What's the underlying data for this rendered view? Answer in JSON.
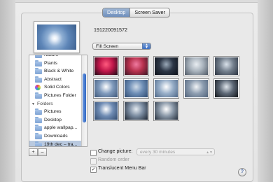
{
  "tabs": [
    {
      "label": "Desktop",
      "active": true
    },
    {
      "label": "Screen Saver",
      "active": false
    }
  ],
  "preview": {
    "image_name": "191220091572"
  },
  "fit_popup": {
    "selected": "Fill Screen"
  },
  "source_list": {
    "items": [
      {
        "label": "Nature",
        "icon": "folder-icon"
      },
      {
        "label": "Plants",
        "icon": "folder-icon"
      },
      {
        "label": "Black & White",
        "icon": "folder-icon"
      },
      {
        "label": "Abstract",
        "icon": "folder-icon"
      },
      {
        "label": "Solid Colors",
        "icon": "color-wheel-icon"
      },
      {
        "label": "Pictures Folder",
        "icon": "folder-icon"
      }
    ],
    "folders_header": "Folders",
    "folders": [
      {
        "label": "Pictures",
        "icon": "folder-icon"
      },
      {
        "label": "Desktop",
        "icon": "folder-icon"
      },
      {
        "label": "apple wallpap...",
        "icon": "folder-icon"
      },
      {
        "label": "Downloads",
        "icon": "folder-icon"
      },
      {
        "label": "19th dec – tra...",
        "icon": "folder-icon",
        "selected": true
      }
    ],
    "add_label": "+",
    "remove_label": "–"
  },
  "thumbnails": [
    {
      "name": "flowers-red",
      "colors": [
        "#1b0a14",
        "#c0164a",
        "#ff5a7e"
      ]
    },
    {
      "name": "flowers-pink",
      "colors": [
        "#3a1624",
        "#b8314e",
        "#f07aa0"
      ]
    },
    {
      "name": "dark-tree-sky",
      "colors": [
        "#0c1018",
        "#2c3646",
        "#9aa9b8"
      ]
    },
    {
      "name": "cloudy-sky-1",
      "colors": [
        "#4f5965",
        "#a9b3bd",
        "#e8edf1"
      ]
    },
    {
      "name": "cloudy-sky-2",
      "colors": [
        "#2b3340",
        "#74808e",
        "#d9e1ea"
      ]
    },
    {
      "name": "sun-sky-1",
      "colors": [
        "#3d5678",
        "#7f9abc",
        "#ffffff"
      ]
    },
    {
      "name": "blue-sky-1",
      "colors": [
        "#2e4a70",
        "#6d8db5",
        "#cfdbe8"
      ]
    },
    {
      "name": "bright-clouds",
      "colors": [
        "#4d6686",
        "#97aec8",
        "#ffffff"
      ]
    },
    {
      "name": "clouds-gray",
      "colors": [
        "#50627a",
        "#8d9db0",
        "#f2f4f6"
      ]
    },
    {
      "name": "tree-silhouette",
      "colors": [
        "#111418",
        "#5d6876",
        "#dfe5eb"
      ]
    },
    {
      "name": "sun-sky-2",
      "colors": [
        "#30496c",
        "#6f8cb4",
        "#ffffff"
      ]
    },
    {
      "name": "sky-horizon",
      "colors": [
        "#1c2430",
        "#7a8ba0",
        "#e5ebf1"
      ]
    },
    {
      "name": "sun-ground",
      "colors": [
        "#26303d",
        "#8a98a8",
        "#ffffff"
      ]
    }
  ],
  "change_picture": {
    "label": "Change picture:",
    "checked": false,
    "interval": "every 30 minutes"
  },
  "random_order": {
    "label": "Random order",
    "checked": false
  },
  "translucent_menu": {
    "label": "Translucent Menu Bar",
    "checked": true
  },
  "help_label": "?"
}
